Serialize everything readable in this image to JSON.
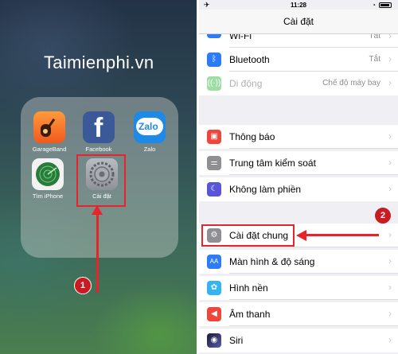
{
  "left": {
    "brand": "Taimienphi.vn",
    "apps": [
      {
        "label": "GarageBand"
      },
      {
        "label": "Facebook",
        "glyph": "f"
      },
      {
        "label": "Zalo",
        "glyph": "Zalo"
      },
      {
        "label": "Tìm iPhone"
      },
      {
        "label": "Cài đặt"
      }
    ],
    "step_badge": "1"
  },
  "right": {
    "status": {
      "time": "11:28"
    },
    "nav_title": "Cài đặt",
    "rows": [
      {
        "label": "Wi-Fi",
        "value": "Tắt",
        "icon": "wifi-icon",
        "color": "#2d7cf6"
      },
      {
        "label": "Bluetooth",
        "value": "Tắt",
        "icon": "bluetooth-icon",
        "color": "#2d7cf6"
      },
      {
        "label": "Di động",
        "value": "Chế độ máy bay",
        "icon": "cellular-icon",
        "color": "#7fd08a"
      },
      {
        "label": "Thông báo",
        "icon": "notifications-icon",
        "color": "#f0453a"
      },
      {
        "label": "Trung tâm kiểm soát",
        "icon": "control-center-icon",
        "color": "#8e8e93"
      },
      {
        "label": "Không làm phiền",
        "icon": "moon-icon",
        "color": "#5856d6"
      },
      {
        "label": "Cài đặt chung",
        "icon": "gear-icon",
        "color": "#8e8e93"
      },
      {
        "label": "Màn hình & độ sáng",
        "icon": "display-icon",
        "color": "#2d7cf6"
      },
      {
        "label": "Hình nền",
        "icon": "wallpaper-icon",
        "color": "#35b5f0"
      },
      {
        "label": "Âm thanh",
        "icon": "sound-icon",
        "color": "#f0453a"
      },
      {
        "label": "Siri",
        "icon": "siri-icon",
        "color": "#3a3a3c"
      }
    ],
    "step_badge": "2"
  }
}
